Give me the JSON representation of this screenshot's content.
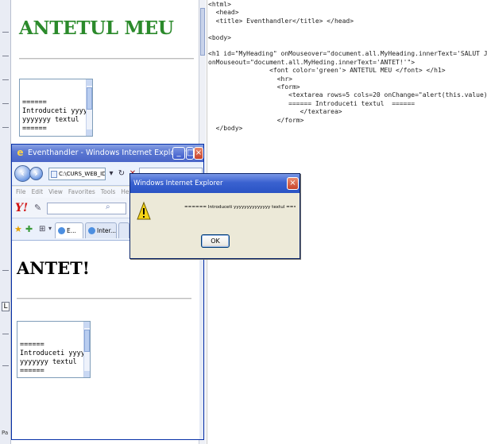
{
  "background_page": {
    "heading": "ANTETUL MEU",
    "heading_color": "#2b8a2b",
    "textarea_lines": [
      "======",
      "Introduceti yyyyyyy",
      "yyyyyyy textul",
      "======"
    ]
  },
  "code": {
    "lines": [
      "<html>",
      "  <head>",
      "  <title> Eventhandler</title> </head>",
      "",
      "<body>",
      "",
      "<h1 id=\"MyHeading\" onMouseover=\"document.all.MyHeading.innerText='SALUT JavaScript !'\"",
      "onMouseout=\"document.all.MyHeding.innerText='ANTET!'\">",
      "                <font color='green'> ANTETUL MEU </font> </h1>",
      "                  <hr>",
      "                  <form>",
      "                     <textarea rows=5 cols=20 onChange=\"alert(this.value)\">",
      "                     ====== Introduceti textul  ======",
      "                        </textarea>",
      "                  </form>",
      "  </body>"
    ]
  },
  "ie": {
    "title": "Eventhandler - Windows Internet Explorer provided by Ya...",
    "address": "C:\\CURS_WEB_ID_FR",
    "menu": [
      "File",
      "Edit",
      "View",
      "Favorites",
      "Tools",
      "Help"
    ],
    "tabs": [
      "E...",
      "Inter..."
    ],
    "heading": "ANTET!",
    "textarea_lines": [
      "======",
      "Introduceti yyyyyyy",
      "yyyyyyy textul",
      "======"
    ]
  },
  "dialog": {
    "title": "Windows Internet Explorer",
    "message": "====== Introduceti yyyyyyyyyyyyyy textul ======",
    "ok_label": "OK"
  },
  "ruler_mark": "L",
  "status_fragment": "Pa"
}
